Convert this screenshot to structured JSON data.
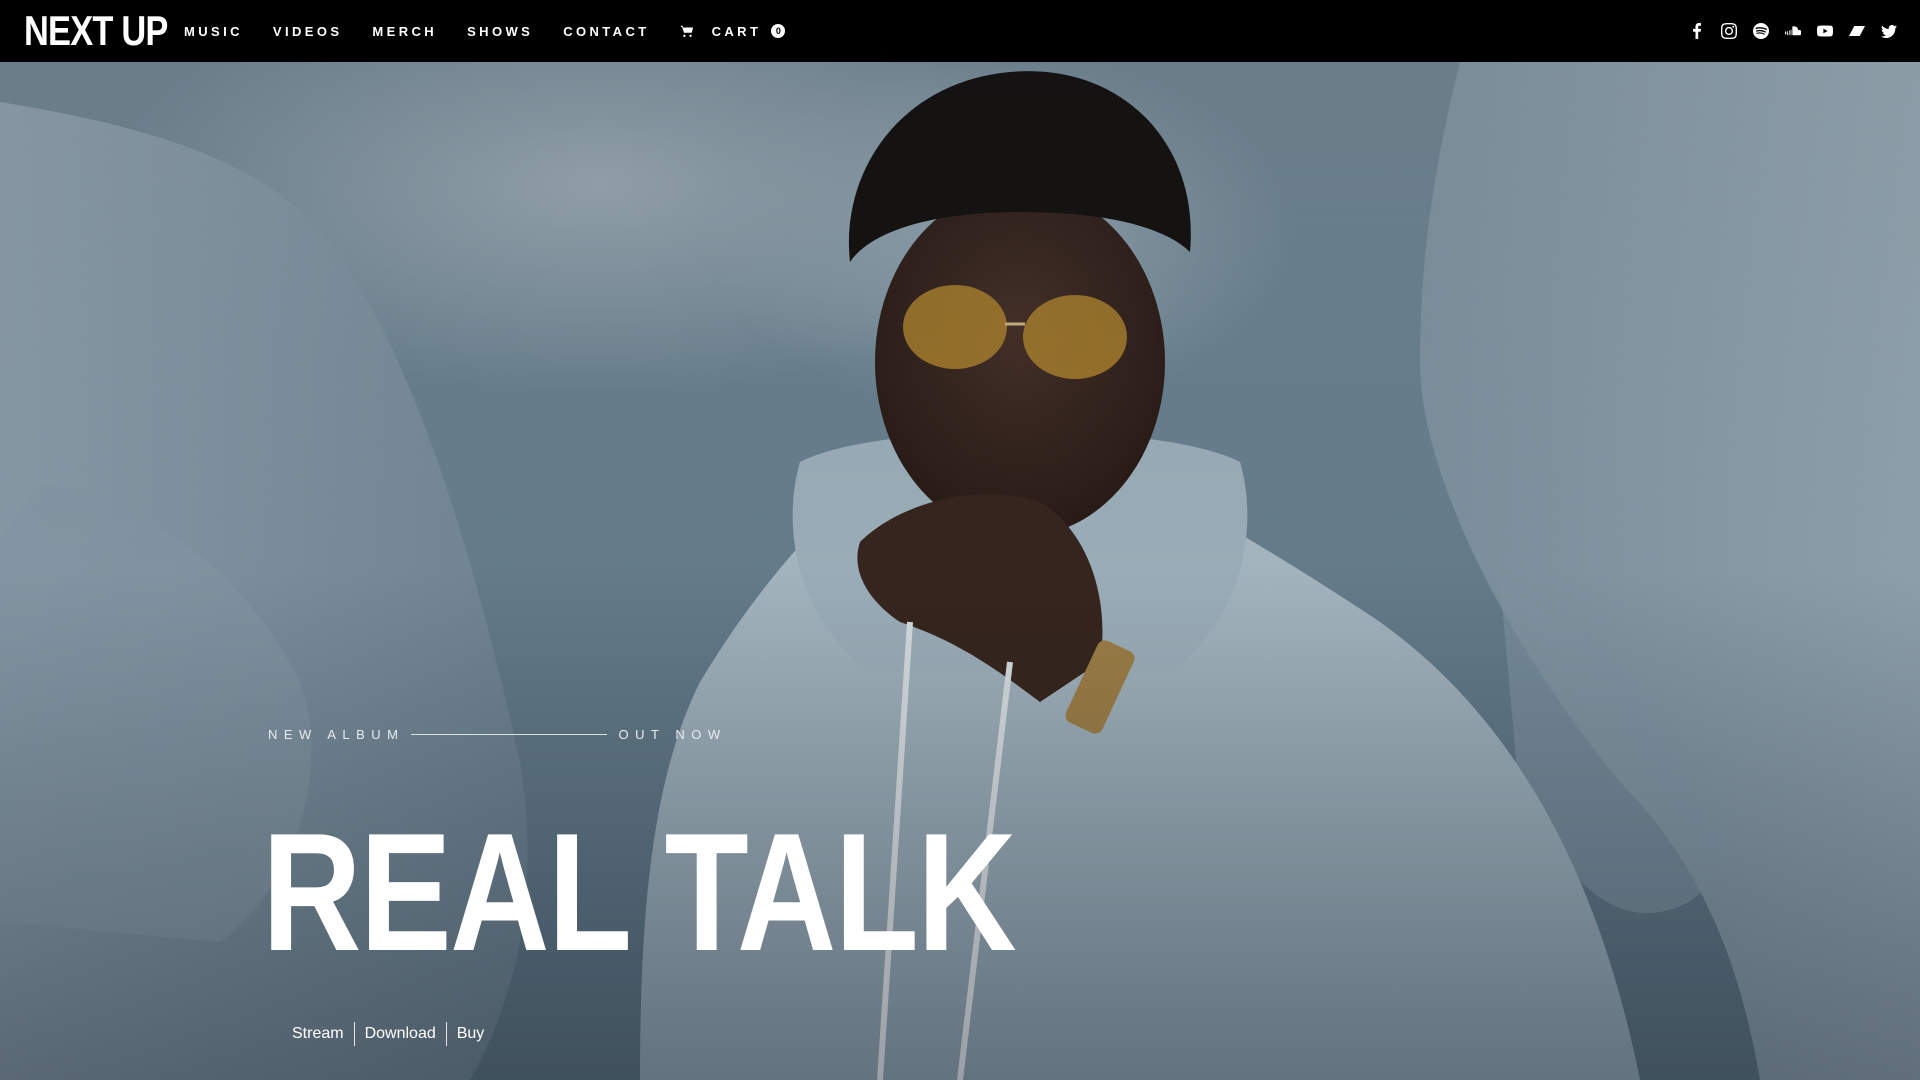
{
  "brand": {
    "logo": "NEXT UP"
  },
  "nav": {
    "links": [
      {
        "label": "MUSIC"
      },
      {
        "label": "VIDEOS"
      },
      {
        "label": "MERCH"
      },
      {
        "label": "SHOWS"
      },
      {
        "label": "CONTACT"
      }
    ],
    "cart": {
      "label": "CART",
      "count": "0",
      "icon": "cart-icon"
    }
  },
  "social": [
    {
      "icon": "facebook-icon"
    },
    {
      "icon": "instagram-icon"
    },
    {
      "icon": "spotify-icon"
    },
    {
      "icon": "soundcloud-icon"
    },
    {
      "icon": "youtube-icon"
    },
    {
      "icon": "bandcamp-icon"
    },
    {
      "icon": "twitter-icon"
    }
  ],
  "hero": {
    "eyebrow_left": "NEW ALBUM",
    "eyebrow_right": "OUT NOW",
    "title": "REAL TALK",
    "actions": [
      {
        "label": "Stream"
      },
      {
        "label": "Download"
      },
      {
        "label": "Buy"
      }
    ]
  }
}
